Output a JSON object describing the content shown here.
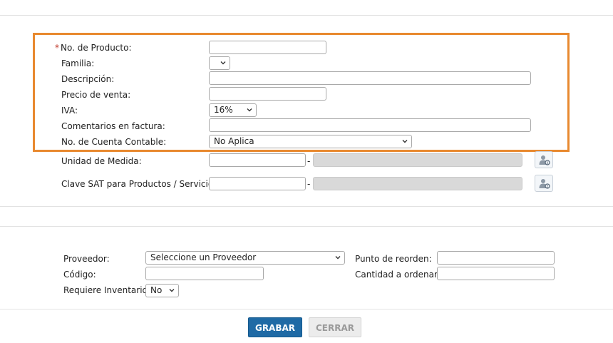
{
  "form": {
    "product_number": {
      "required_mark": "*",
      "label": "No. de Producto:",
      "value": ""
    },
    "family": {
      "label": "Familia:",
      "value": ""
    },
    "description": {
      "label": "Descripción:",
      "value": ""
    },
    "price": {
      "label": "Precio de venta:",
      "value": ""
    },
    "iva": {
      "label": "IVA:",
      "value": "16%"
    },
    "invoice_comments": {
      "label": "Comentarios en factura:",
      "value": ""
    },
    "account": {
      "label": "No. de Cuenta Contable:",
      "value": "No Aplica"
    },
    "unit": {
      "label": "Unidad de Medida:",
      "separator": "-"
    },
    "sat_key": {
      "label": "Clave SAT para Productos / Servicios:",
      "separator": "-"
    }
  },
  "supplier": {
    "provider": {
      "label": "Proveedor:",
      "value": "Seleccione un Proveedor"
    },
    "code": {
      "label": "Código:"
    },
    "requires_inventory": {
      "label": "Requiere Inventario:",
      "value": "No"
    },
    "reorder_point": {
      "label": "Punto de reorden:"
    },
    "order_quantity": {
      "label": "Cantidad a ordenar:"
    }
  },
  "buttons": {
    "save": "GRABAR",
    "close": "CERRAR"
  },
  "colors": {
    "highlight": "#e8892f",
    "primary": "#1f6aa5",
    "required": "#c0392b"
  },
  "icons": {
    "lookup": "person-search-icon",
    "dropdown": "chevron-down-icon"
  }
}
